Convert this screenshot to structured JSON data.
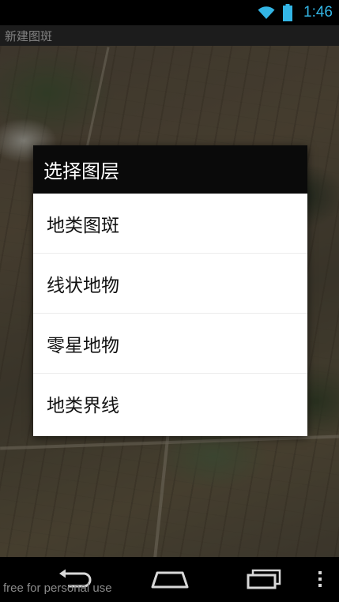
{
  "status_bar": {
    "time": "1:46",
    "wifi_icon": "wifi-icon",
    "battery_icon": "battery-icon",
    "accent_color": "#33b5e5"
  },
  "app": {
    "title": "新建图斑"
  },
  "dialog": {
    "title": "选择图层",
    "items": [
      {
        "label": "地类图斑"
      },
      {
        "label": "线状地物"
      },
      {
        "label": "零星地物"
      },
      {
        "label": "地类界线"
      }
    ]
  },
  "nav_bar": {
    "back_icon": "back-icon",
    "home_icon": "home-icon",
    "recent_icon": "recent-apps-icon",
    "overflow_icon": "overflow-menu-icon",
    "footer_note": "free for personal use"
  }
}
